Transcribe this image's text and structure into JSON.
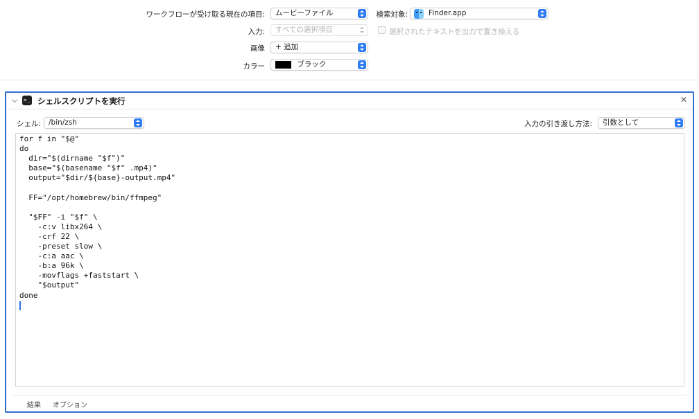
{
  "header": {
    "workflow_input_label": "ワークフローが受け取る現在の項目:",
    "workflow_input_value": "ムービーファイル",
    "search_target_label": "検索対象:",
    "search_target_value": "Finder.app",
    "input_label": "入力:",
    "input_value": "すべての選択項目",
    "replace_checkbox_label": "選択されたテキストを出力で置き換える",
    "image_label": "画像",
    "image_value": "+ 追加",
    "color_label": "カラー",
    "color_value": "ブラック",
    "color_swatch": "#000000"
  },
  "action": {
    "title": "シェルスクリプトを実行",
    "icon": "terminal-icon",
    "close_glyph": "✕",
    "shell_label": "シェル:",
    "shell_value": "/bin/zsh",
    "pass_input_label": "入力の引き渡し方法:",
    "pass_input_value": "引数として",
    "script": "for f in \"$@\"\ndo\n  dir=\"$(dirname \"$f\")\"\n  base=\"$(basename \"$f\" .mp4)\"\n  output=\"$dir/${base}-output.mp4\"\n\n  FF=\"/opt/homebrew/bin/ffmpeg\"\n\n  \"$FF\" -i \"$f\" \\\n    -c:v libx264 \\\n    -crf 22 \\\n    -preset slow \\\n    -c:a aac \\\n    -b:a 96k \\\n    -movflags +faststart \\\n    \"$output\"\ndone",
    "tabs": [
      "結果",
      "オプション"
    ]
  },
  "colors": {
    "accent": "#2f7cf6",
    "selection_border": "#2e6ecf"
  }
}
